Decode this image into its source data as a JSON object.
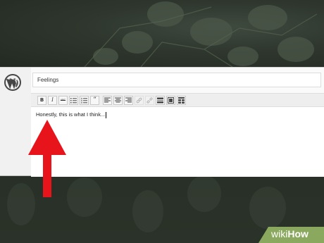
{
  "post": {
    "title_value": "Feelings",
    "body_text": "Honestly, this is what I think..."
  },
  "toolbar": {
    "buttons": [
      {
        "name": "bold-button",
        "glyph": "B"
      },
      {
        "name": "italic-button",
        "glyph": "I"
      },
      {
        "name": "strikethrough-button",
        "glyph": "ABC"
      },
      {
        "name": "bullet-list-button",
        "glyph": "•≡"
      },
      {
        "name": "numbered-list-button",
        "glyph": "1≡"
      },
      {
        "name": "blockquote-button",
        "glyph": "“"
      },
      {
        "name": "align-left-button",
        "glyph": "≡"
      },
      {
        "name": "align-center-button",
        "glyph": "≡"
      },
      {
        "name": "align-right-button",
        "glyph": "≡"
      },
      {
        "name": "insert-link-button",
        "glyph": "∞"
      },
      {
        "name": "remove-link-button",
        "glyph": "⌧"
      },
      {
        "name": "read-more-button",
        "glyph": "▭"
      },
      {
        "name": "fullscreen-button",
        "glyph": "⛶"
      },
      {
        "name": "kitchen-sink-button",
        "glyph": "▦"
      }
    ]
  },
  "branding": {
    "wikihow_prefix": "wiki",
    "wikihow_suffix": "How"
  },
  "colors": {
    "arrow": "#e8141b",
    "wikihow_green": "#8aa85e",
    "background": "#2a3129"
  }
}
